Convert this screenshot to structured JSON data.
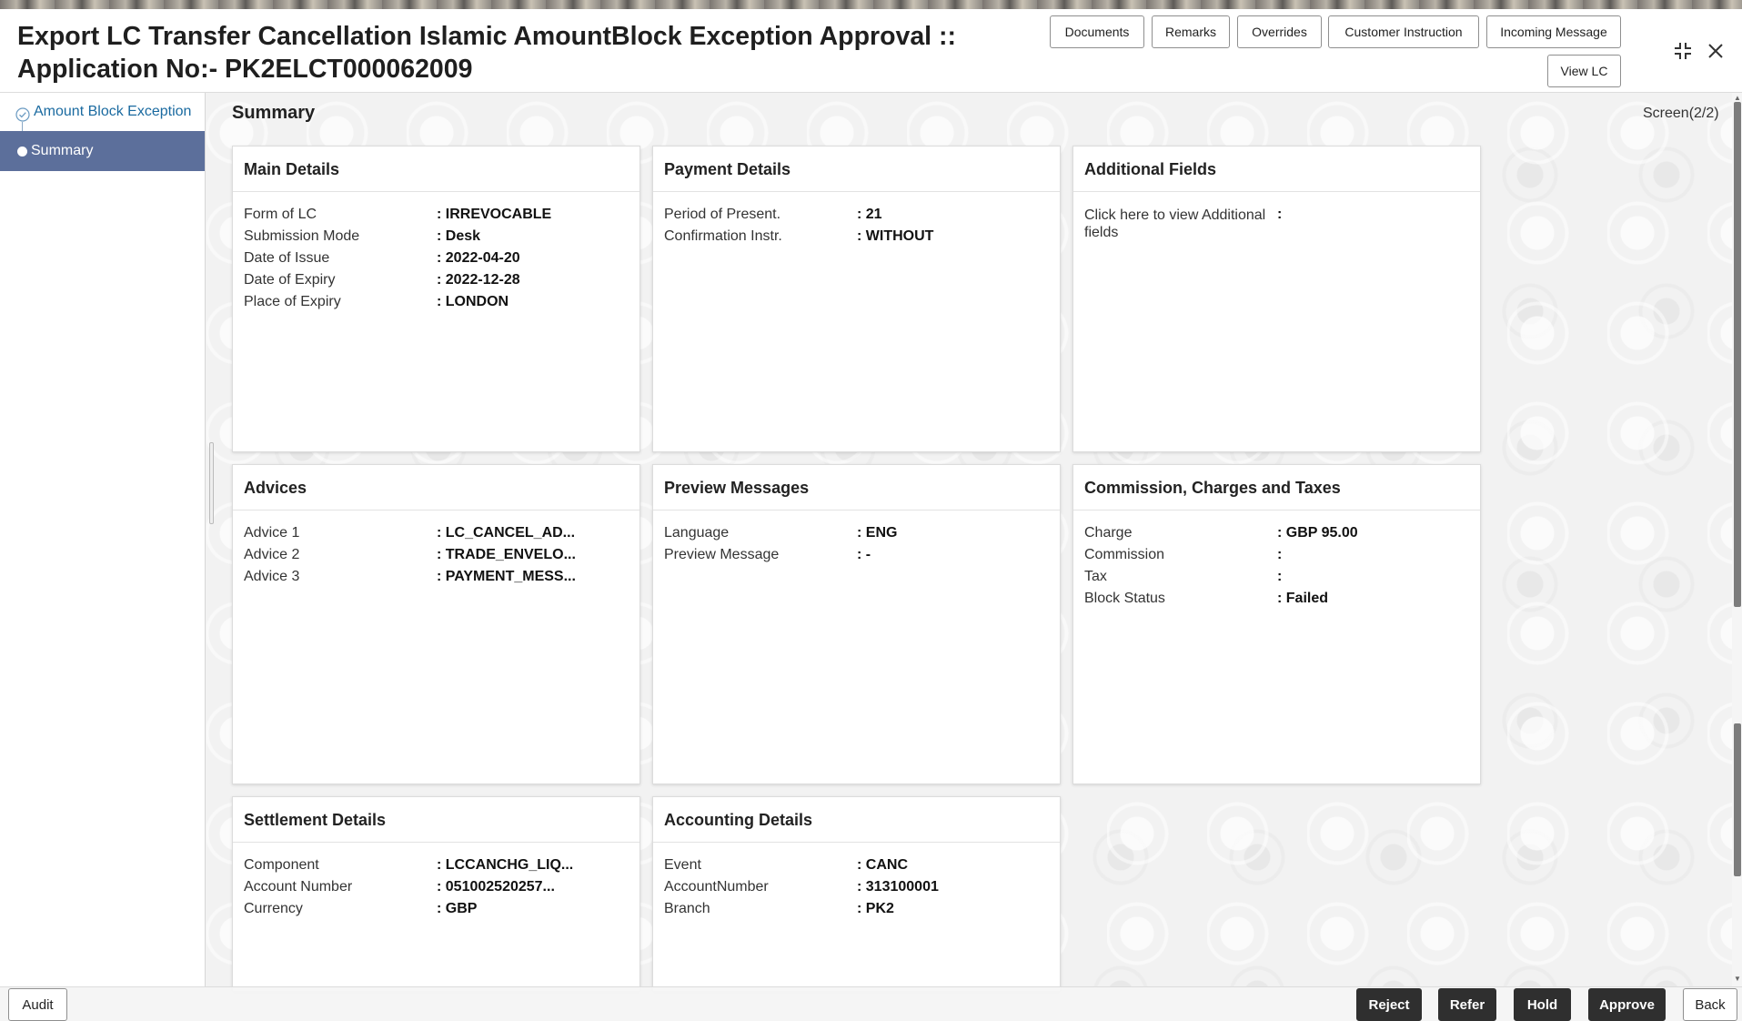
{
  "header": {
    "title_line1": "Export LC Transfer Cancellation Islamic AmountBlock Exception Approval ::",
    "title_line2": "Application No:- PK2ELCT000062009",
    "buttons": {
      "documents": "Documents",
      "remarks": "Remarks",
      "overrides": "Overrides",
      "customer_instruction": "Customer Instruction",
      "incoming_message": "Incoming Message",
      "view_lc": "View LC"
    },
    "icons": {
      "collapse": "collapse-icon",
      "close": "close-icon"
    }
  },
  "sidebar": {
    "items": [
      {
        "label": "Amount Block Exception",
        "state": "completed",
        "icon": "check-circle-icon"
      },
      {
        "label": "Summary",
        "state": "active",
        "icon": "dot-icon"
      }
    ]
  },
  "main": {
    "title": "Summary",
    "screen_indicator": "Screen(2/2)"
  },
  "cards": {
    "main_details": {
      "title": "Main Details",
      "rows": [
        {
          "key": "Form of LC",
          "value": ": IRREVOCABLE"
        },
        {
          "key": "Submission Mode",
          "value": ": Desk"
        },
        {
          "key": "Date of Issue",
          "value": ": 2022-04-20"
        },
        {
          "key": "Date of Expiry",
          "value": ": 2022-12-28"
        },
        {
          "key": "Place of Expiry",
          "value": ": LONDON"
        }
      ]
    },
    "payment_details": {
      "title": "Payment Details",
      "rows": [
        {
          "key": "Period of Present.",
          "value": ": 21"
        },
        {
          "key": "Confirmation Instr.",
          "value": ": WITHOUT"
        }
      ]
    },
    "additional_fields": {
      "title": "Additional Fields",
      "rows": [
        {
          "key": "Click here to view Additional fields",
          "value": ":"
        }
      ]
    },
    "advices": {
      "title": "Advices",
      "rows": [
        {
          "key": "Advice 1",
          "value": ": LC_CANCEL_AD..."
        },
        {
          "key": "Advice 2",
          "value": ": TRADE_ENVELO..."
        },
        {
          "key": "Advice 3",
          "value": ": PAYMENT_MESS..."
        }
      ]
    },
    "preview_messages": {
      "title": "Preview Messages",
      "rows": [
        {
          "key": "Language",
          "value": ": ENG"
        },
        {
          "key": "Preview Message",
          "value": ": -"
        }
      ]
    },
    "commission": {
      "title": "Commission, Charges and Taxes",
      "rows": [
        {
          "key": "Charge",
          "value": ": GBP  95.00"
        },
        {
          "key": "Commission",
          "value": ":"
        },
        {
          "key": "Tax",
          "value": ":"
        },
        {
          "key": "Block Status",
          "value": ": Failed"
        }
      ]
    },
    "settlement_details": {
      "title": "Settlement Details",
      "rows": [
        {
          "key": "Component",
          "value": ": LCCANCHG_LIQ..."
        },
        {
          "key": "Account Number",
          "value": ": 051002520257..."
        },
        {
          "key": "Currency",
          "value": ": GBP"
        }
      ]
    },
    "accounting_details": {
      "title": "Accounting Details",
      "rows": [
        {
          "key": "Event",
          "value": ": CANC"
        },
        {
          "key": "AccountNumber",
          "value": ": 313100001"
        },
        {
          "key": "Branch",
          "value": ": PK2"
        }
      ]
    }
  },
  "footer": {
    "audit": "Audit",
    "reject": "Reject",
    "refer": "Refer",
    "hold": "Hold",
    "approve": "Approve",
    "back": "Back"
  },
  "colors": {
    "sidebar_active_bg": "#5c6f9b",
    "sidebar_link": "#1a6aa0",
    "primary_button": "#2f2f2f"
  }
}
